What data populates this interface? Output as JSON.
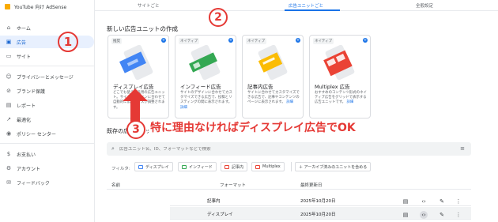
{
  "app": {
    "name": "YouTube 向け AdSense"
  },
  "sidebar": {
    "items": [
      {
        "label": "ホーム",
        "icon": "home-icon"
      },
      {
        "label": "広告",
        "icon": "ads-icon"
      },
      {
        "label": "サイト",
        "icon": "sites-icon"
      },
      {
        "label": "プライバシーとメッセージ",
        "icon": "privacy-icon"
      },
      {
        "label": "ブランド保護",
        "icon": "brand-safety-icon"
      },
      {
        "label": "レポート",
        "icon": "reports-icon"
      },
      {
        "label": "最適化",
        "icon": "optimization-icon"
      },
      {
        "label": "ポリシー センター",
        "icon": "policy-icon"
      },
      {
        "label": "お支払い",
        "icon": "payments-icon"
      },
      {
        "label": "アカウント",
        "icon": "account-icon"
      },
      {
        "label": "フィードバック",
        "icon": "feedback-icon"
      }
    ]
  },
  "tabs": [
    {
      "label": "サイトごと"
    },
    {
      "label": "広告ユニットごと"
    },
    {
      "label": "全般設定"
    }
  ],
  "create_section": {
    "title": "新しい広告ユニットの作成"
  },
  "cards": [
    {
      "badge": "推奨",
      "title": "ディスプレイ広告",
      "desc": "どこでも使える汎用の広告ユニット。サイトのデザインに合わせて自動的に広告サイズが調整されます。",
      "link": ""
    },
    {
      "badge": "ネイティブ",
      "title": "インフィード広告",
      "desc": "サイトのデザインに合わせてカスタマイズできる広告で、投稿とリスティングの間に表示されます。",
      "link": "詳細"
    },
    {
      "badge": "ネイティブ",
      "title": "記事内広告",
      "desc": "サイトに合わせてカスタマイズできる広告で、記事やコンテンツのページに表示されます。",
      "link": "詳細"
    },
    {
      "badge": "ネイティブ",
      "title": "Multiplex 広告",
      "desc": "おすすめのコンテンツ形式のネイティブ広告をグリッドで表示する広告ユニットです。",
      "link": "詳細"
    }
  ],
  "annotations": {
    "one": "1",
    "two": "2",
    "three": "3",
    "text": "特に理由なければディスプレイ広告でOK"
  },
  "existing": {
    "title": "既存の広告ユニット"
  },
  "search": {
    "placeholder": "広告ユニット名、ID、フォーマットなどで検索"
  },
  "filters": {
    "label": "フィルタ:",
    "chips": [
      {
        "label": "ディスプレイ",
        "color": "#4285f4"
      },
      {
        "label": "インフィード",
        "color": "#34a853"
      },
      {
        "label": "記事内",
        "color": "#ea4335"
      },
      {
        "label": "Multiplex",
        "color": "#ea4335"
      }
    ],
    "archived": "＋ アーカイブ済みのユニットを含める"
  },
  "table": {
    "headers": {
      "name": "名前",
      "format": "フォーマット",
      "updated": "最終更新日"
    },
    "rows": [
      {
        "format": "記事内",
        "updated": "2025年10月20日"
      },
      {
        "format": "ディスプレイ",
        "updated": "2025年10月20日"
      }
    ]
  }
}
